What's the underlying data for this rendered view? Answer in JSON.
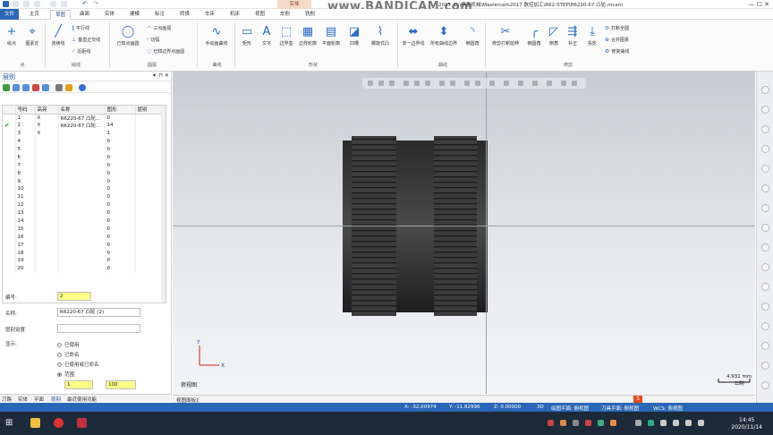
{
  "watermark": "www.BANDICAM.com",
  "window": {
    "title": "D:\\李惠机械\\Mastercam2017 数控加工\\R62-STEP\\R6220-67 凸轮.mcam",
    "title_prefix": "2017",
    "context_tab": "实体"
  },
  "ribbon_tabs": [
    "文件",
    "主页",
    "草图",
    "曲面",
    "实体",
    "建模",
    "标注",
    "转换",
    "车床",
    "机床",
    "视图",
    "车削",
    "铣削"
  ],
  "ribbon": {
    "groups": {
      "point": "点",
      "line": "绘线",
      "arc": "圆弧",
      "curve": "曲线",
      "shape": "形状",
      "modify": "曲线",
      "trim": "修剪"
    },
    "buttons": {
      "point_btn": "绘点",
      "dynamic_btn": "图素定",
      "line_btn": "连续线",
      "parallel": "平行线",
      "perp": "垂直正交线",
      "near": "近距线",
      "circle_center": "已知点画圆",
      "three_pt": "三点画弧",
      "tangent": "切弧",
      "edge_arc": "已知边界点画圆",
      "hand_curve": "手动画曲线",
      "rect": "矩形",
      "text": "文字",
      "box": "边界盒",
      "outline": "边界轮廓",
      "plane_outline": "平面轮廓",
      "bend": "凹槽",
      "spiral": "螺旋式凸",
      "single_edge": "单一边界线",
      "all_edge": "所有曲线边界",
      "fillet": "倒圆角",
      "trim_break": "修剪打断延伸",
      "round": "倒圆角",
      "chamfer": "倒角",
      "offset": "补正",
      "project": "投影",
      "break_all": "打断全圆",
      "join": "合并图素",
      "params": "修复曲线"
    }
  },
  "panel": {
    "title": "层别",
    "columns": [
      "号码",
      "高亮",
      "名称",
      "图形",
      "层别"
    ],
    "rows": [
      {
        "num": "1",
        "hl": "X",
        "name": "R6220-67 凸轮...",
        "count": "0",
        "check": ""
      },
      {
        "num": "2",
        "hl": "X",
        "name": "R6220-67 凸轮...",
        "count": "14",
        "check": "✔"
      },
      {
        "num": "3",
        "hl": "X",
        "name": "",
        "count": "1",
        "check": ""
      },
      {
        "num": "4",
        "hl": "",
        "name": "",
        "count": "0",
        "check": ""
      },
      {
        "num": "5",
        "hl": "",
        "name": "",
        "count": "0",
        "check": ""
      },
      {
        "num": "6",
        "hl": "",
        "name": "",
        "count": "0",
        "check": ""
      },
      {
        "num": "7",
        "hl": "",
        "name": "",
        "count": "0",
        "check": ""
      },
      {
        "num": "8",
        "hl": "",
        "name": "",
        "count": "0",
        "check": ""
      },
      {
        "num": "9",
        "hl": "",
        "name": "",
        "count": "0",
        "check": ""
      },
      {
        "num": "10",
        "hl": "",
        "name": "",
        "count": "0",
        "check": ""
      },
      {
        "num": "11",
        "hl": "",
        "name": "",
        "count": "0",
        "check": ""
      },
      {
        "num": "12",
        "hl": "",
        "name": "",
        "count": "0",
        "check": ""
      },
      {
        "num": "13",
        "hl": "",
        "name": "",
        "count": "0",
        "check": ""
      },
      {
        "num": "14",
        "hl": "",
        "name": "",
        "count": "0",
        "check": ""
      },
      {
        "num": "15",
        "hl": "",
        "name": "",
        "count": "0",
        "check": ""
      },
      {
        "num": "16",
        "hl": "",
        "name": "",
        "count": "0",
        "check": ""
      },
      {
        "num": "17",
        "hl": "",
        "name": "",
        "count": "0",
        "check": ""
      },
      {
        "num": "18",
        "hl": "",
        "name": "",
        "count": "0",
        "check": ""
      },
      {
        "num": "19",
        "hl": "",
        "name": "",
        "count": "0",
        "check": ""
      },
      {
        "num": "20",
        "hl": "",
        "name": "",
        "count": "0",
        "check": ""
      }
    ],
    "fields": {
      "number_label": "编号:",
      "number_value": "2",
      "name_label": "名称:",
      "name_value": "R6220-67 凸轮 (2)",
      "set_label": "层别设置",
      "set_value": "",
      "display_label": "显示:",
      "opt1": "已使用",
      "opt2": "已命名",
      "opt3": "已使用或已命名",
      "opt4": "范围",
      "range_from": "1",
      "range_to": "100"
    },
    "tabs": [
      "刀路",
      "实体",
      "平面",
      "层别",
      "最近使用功能"
    ]
  },
  "viewport": {
    "view_name": "俯视图",
    "scale_value": "4.931 mm",
    "scale_unit": "公制",
    "tab": "视图面板1",
    "axis_x": "X",
    "axis_y": "Y"
  },
  "status": {
    "x": "X:   -32.00974",
    "y": "Y:   -11.82996",
    "z": "Z:   0.00000",
    "mode": "3D",
    "cplane": "绘图平面: 俯视图",
    "tplane": "刀具平面: 俯视图",
    "wcs": "WCS: 俯视图"
  },
  "clock": {
    "time": "14:45",
    "date": "2020/11/14"
  },
  "colors": {
    "ribbon_blue": "#2a67b6",
    "highlight_yellow": "#ffff88"
  }
}
